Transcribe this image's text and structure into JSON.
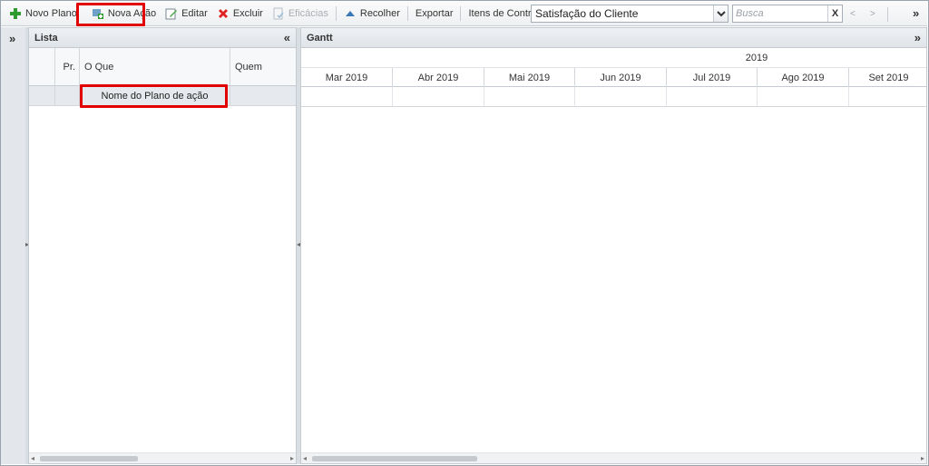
{
  "toolbar": {
    "novo_plano": "Novo Plano",
    "nova_acao": "Nova Ação",
    "editar": "Editar",
    "excluir": "Excluir",
    "eficacias": "Eficácias",
    "recolher": "Recolher",
    "exportar": "Exportar",
    "itens_label": "Itens de Controle:",
    "itens_value": "Satisfação do Cliente",
    "search_placeholder": "Busca",
    "clear": "X",
    "prev": "<",
    "next": ">",
    "overflow": "»"
  },
  "lista": {
    "title": "Lista",
    "collapse": "«",
    "columns": [
      "Pr.",
      "O Que",
      "Quem"
    ],
    "rows": [
      {
        "pr": "",
        "oque": "Nome do Plano de ação",
        "quem": ""
      }
    ]
  },
  "strip": {
    "expand": "»"
  },
  "gantt": {
    "title": "Gantt",
    "expand": "»",
    "year": "2019",
    "months": [
      "Mar 2019",
      "Abr 2019",
      "Mai 2019",
      "Jun 2019",
      "Jul 2019",
      "Ago 2019",
      "Set 2019"
    ]
  },
  "colors": {
    "highlight": "#e00000",
    "add_green": "#2e9b2e",
    "delete_red": "#e02424"
  }
}
